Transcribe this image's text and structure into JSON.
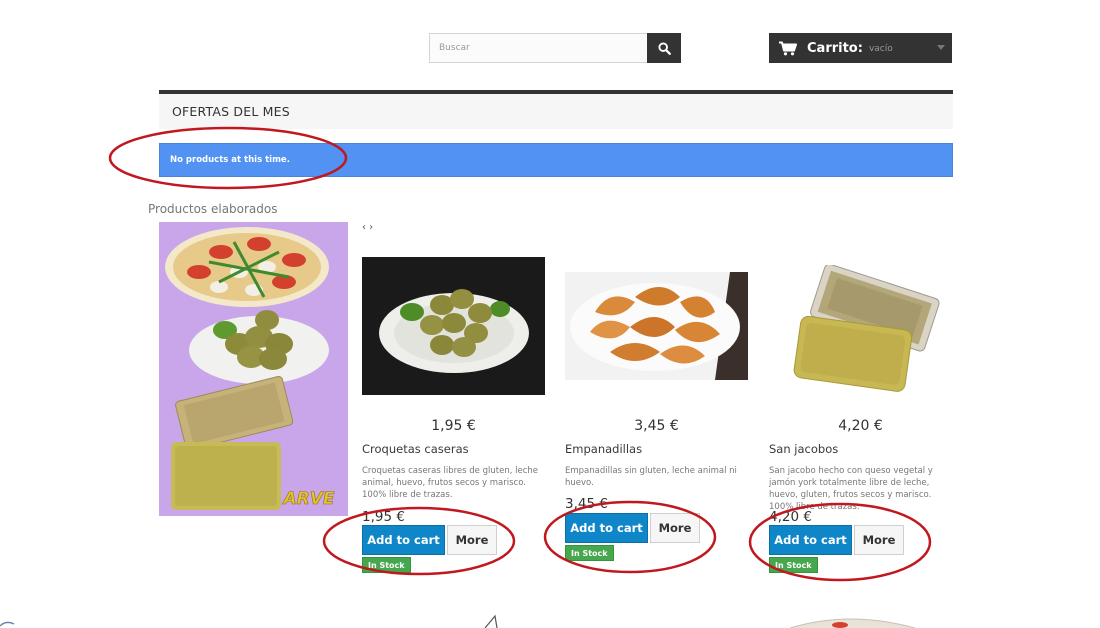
{
  "search": {
    "placeholder": "Buscar",
    "icon": "search-icon"
  },
  "cart": {
    "label": "Carrito:",
    "status": "vacío",
    "icon": "shopping-cart-icon"
  },
  "ofertas": {
    "title": "OFERTAS DEL MES",
    "alert": "No products at this time."
  },
  "section": {
    "title": "Productos elaborados"
  },
  "banner": {
    "logo": "ARVE"
  },
  "carousel": {
    "arrows": "‹ ›"
  },
  "products": [
    {
      "price": "1,95 €",
      "name": "Croquetas caseras",
      "description": "Croquetas caseras libres de gluten, leche animal, huevo, frutos secos y marisco. 100% libre de trazas.",
      "price_inline": "1,95 €",
      "add_label": "Add to cart",
      "more_label": "More",
      "stock": "In Stock"
    },
    {
      "price": "3,45 €",
      "name": "Empanadillas",
      "description": "Empanadillas sin gluten, leche animal ni huevo.",
      "price_inline": "3,45 €",
      "add_label": "Add to cart",
      "more_label": "More",
      "stock": "In Stock"
    },
    {
      "price": "4,20 €",
      "name": "San jacobos",
      "description": "San jacobo hecho con queso vegetal y jamón york totalmente libre de leche, huevo, gluten, frutos secos y marisco. 100% libre de trazas.",
      "price_inline": "4,20 €",
      "add_label": "Add to cart",
      "more_label": "More",
      "stock": "In Stock"
    }
  ],
  "colors": {
    "accent_blue": "#0f86c8",
    "alert_blue": "#5192f3",
    "stock_green": "#46a74e",
    "dark": "#333333",
    "annotation_red": "#c0181e"
  }
}
